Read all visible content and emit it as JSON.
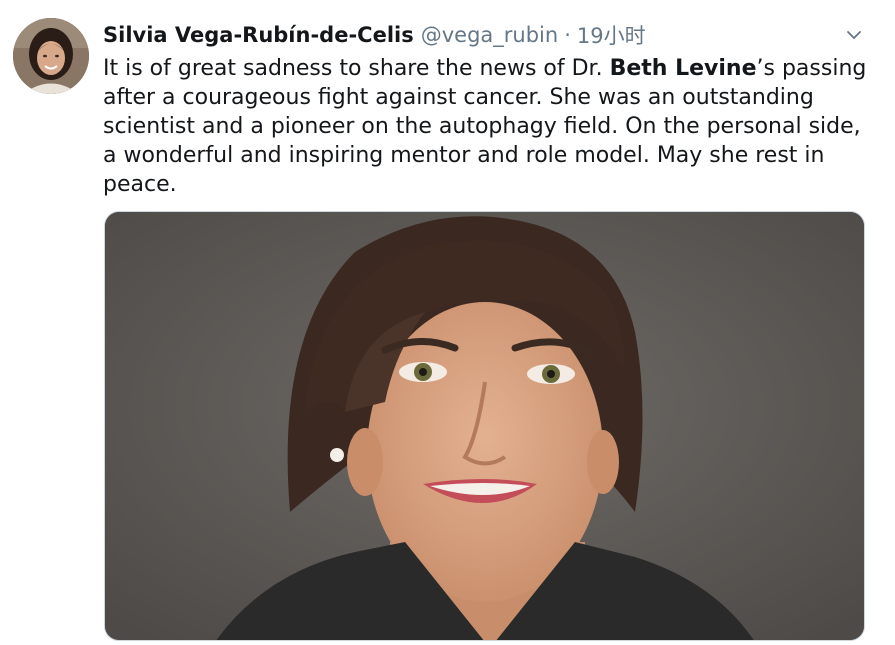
{
  "tweet": {
    "author_name": "Silvia Vega-Rubín-de-Celis",
    "author_handle": "@vega_rubin",
    "separator": "·",
    "timestamp": "19小时",
    "text_before": "It is of great sadness to share the news of Dr. ",
    "text_bold": "Beth Levine",
    "text_after": "’s passing after a courageous fight against cancer. She was an outstanding scientist and a pioneer on the autophagy field. On the personal side, a wonderful and inspiring mentor and role model. May she rest in peace.",
    "avatar_icon": "profile-photo",
    "menu_icon": "chevron-down-icon",
    "media": "portrait-photo"
  },
  "colors": {
    "primary_text": "#14171a",
    "secondary_text": "#657786",
    "border": "#ccd6dd"
  }
}
